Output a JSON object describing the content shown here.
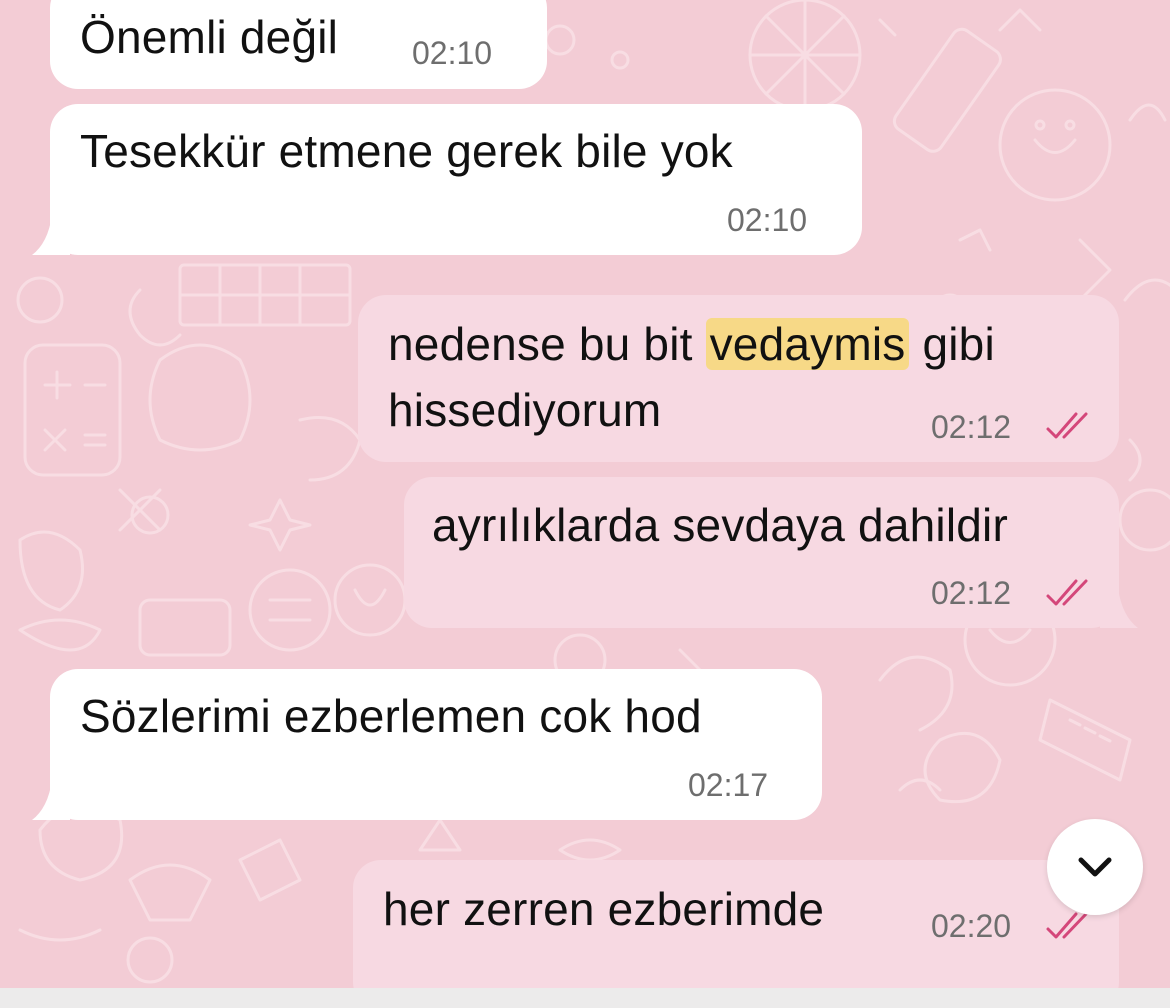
{
  "messages": [
    {
      "direction": "incoming",
      "text": "Önemli değil",
      "time": "02:10"
    },
    {
      "direction": "incoming",
      "text": "Tesekkür etmene gerek bile yok",
      "time": "02:10"
    },
    {
      "direction": "outgoing",
      "text_before": "nedense bu bit",
      "highlight": "vedaymis",
      "text_after": "gibi",
      "text_line2": "hissediyorum",
      "time": "02:12",
      "status": "read"
    },
    {
      "direction": "outgoing",
      "text": "ayrılıklarda sevdaya dahildir",
      "time": "02:12",
      "status": "read"
    },
    {
      "direction": "incoming",
      "text": "Sözlerimi ezberlemen cok hod",
      "time": "02:17"
    },
    {
      "direction": "outgoing",
      "text": "her zerren ezberimde",
      "time": "02:20",
      "status": "read"
    }
  ],
  "scroll_button": {
    "icon": "chevron-down-icon"
  },
  "colors": {
    "wallpaper": "#f3ccd5",
    "incoming_bubble": "#ffffff",
    "outgoing_bubble": "#f7d9e2",
    "read_ticks": "#d4477a",
    "search_highlight": "#f7d987"
  }
}
